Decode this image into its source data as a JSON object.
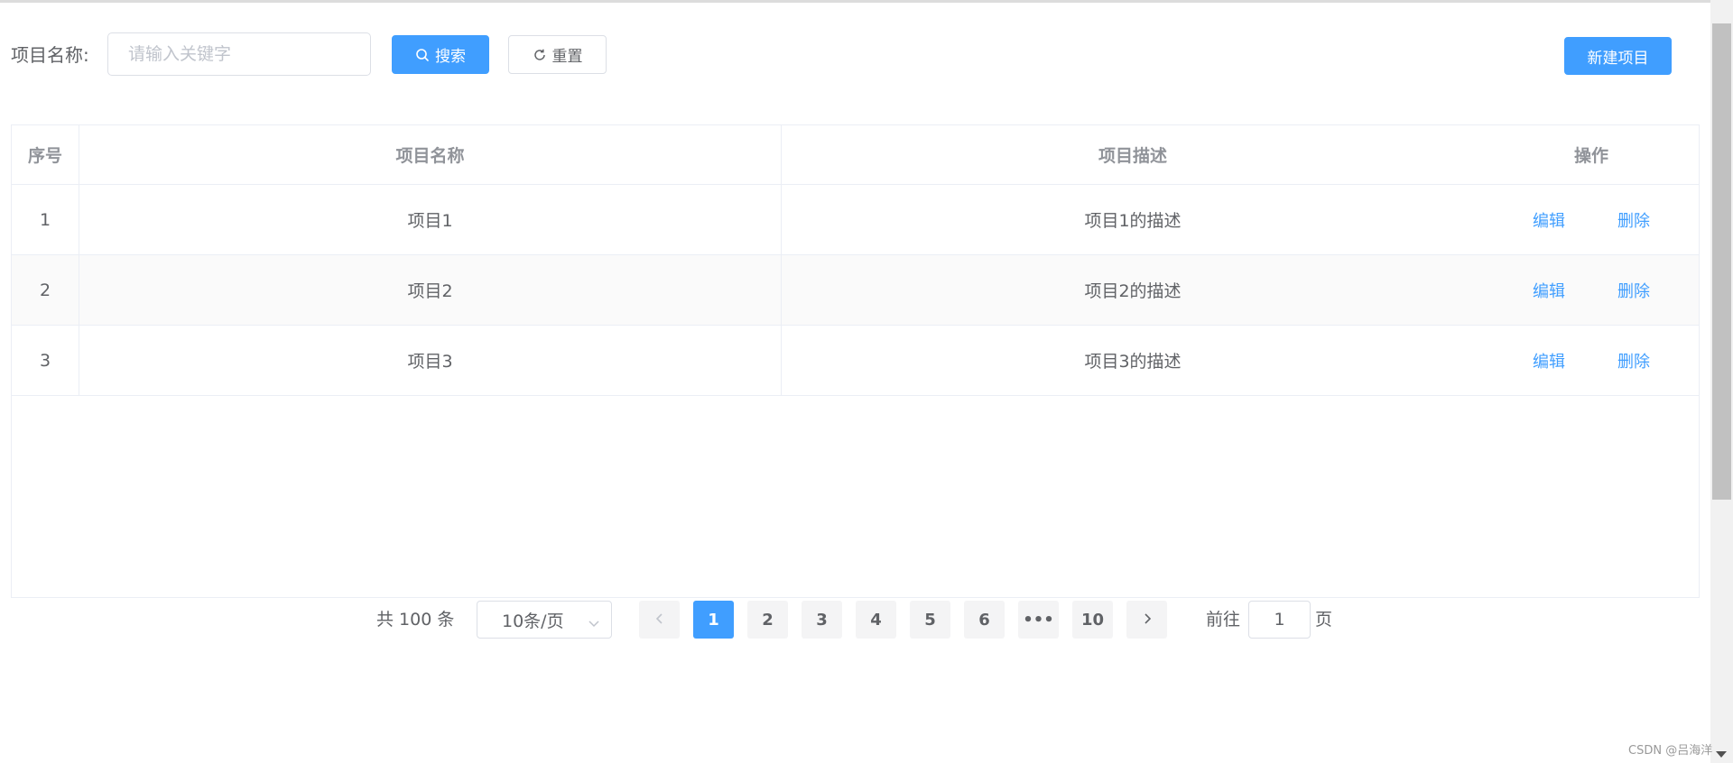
{
  "toolbar": {
    "label": "项目名称:",
    "search_placeholder": "请输入关键字",
    "search_value": "",
    "search_button": "搜索",
    "reset_button": "重置",
    "new_button": "新建项目"
  },
  "table": {
    "headers": [
      "序号",
      "项目名称",
      "项目描述",
      "操作"
    ],
    "rows": [
      {
        "index": "1",
        "name": "项目1",
        "description": "项目1的描述",
        "edit": "编辑",
        "delete": "删除"
      },
      {
        "index": "2",
        "name": "项目2",
        "description": "项目2的描述",
        "edit": "编辑",
        "delete": "删除"
      },
      {
        "index": "3",
        "name": "项目3",
        "description": "项目3的描述",
        "edit": "编辑",
        "delete": "删除"
      }
    ]
  },
  "pagination": {
    "total": "共 100 条",
    "page_size": "10条/页",
    "pages": [
      "1",
      "2",
      "3",
      "4",
      "5",
      "6",
      "•••",
      "10"
    ],
    "current_page": "1",
    "goto_label": "前往",
    "goto_value": "1",
    "goto_suffix": "页"
  },
  "watermark": "CSDN @吕海洋",
  "colors": {
    "primary": "#409eff",
    "border": "#dcdfe6",
    "text": "#606266",
    "header_text": "#909399"
  },
  "icons": {
    "search": "search-icon",
    "reset": "refresh-icon",
    "prev": "chevron-left-icon",
    "next": "chevron-right-icon",
    "select": "chevron-down-icon"
  }
}
